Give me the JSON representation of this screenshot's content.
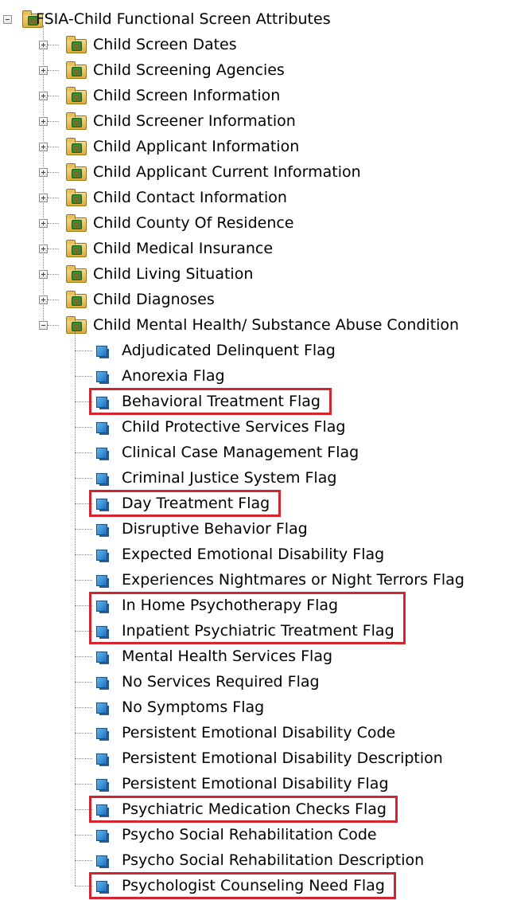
{
  "root": {
    "label": "FSIA-Child Functional Screen Attributes",
    "expanded": true,
    "folders": [
      {
        "label": "Child Screen Dates",
        "expanded": false
      },
      {
        "label": "Child Screening Agencies",
        "expanded": false
      },
      {
        "label": "Child Screen Information",
        "expanded": false
      },
      {
        "label": "Child Screener Information",
        "expanded": false
      },
      {
        "label": "Child Applicant Information",
        "expanded": false
      },
      {
        "label": "Child Applicant Current Information",
        "expanded": false
      },
      {
        "label": "Child Contact Information",
        "expanded": false
      },
      {
        "label": "Child County Of Residence",
        "expanded": false
      },
      {
        "label": "Child Medical Insurance",
        "expanded": false
      },
      {
        "label": "Child Living Situation",
        "expanded": false
      },
      {
        "label": "Child Diagnoses",
        "expanded": false
      },
      {
        "label": "Child Mental Health/ Substance Abuse Condition",
        "expanded": true,
        "items": [
          {
            "label": "Adjudicated Delinquent Flag",
            "highlighted": false
          },
          {
            "label": "Anorexia Flag",
            "highlighted": false
          },
          {
            "label": "Behavioral Treatment Flag",
            "highlighted": true
          },
          {
            "label": "Child Protective Services Flag",
            "highlighted": false
          },
          {
            "label": "Clinical Case Management Flag",
            "highlighted": false
          },
          {
            "label": "Criminal Justice System Flag",
            "highlighted": false
          },
          {
            "label": "Day Treatment Flag",
            "highlighted": true
          },
          {
            "label": "Disruptive Behavior Flag",
            "highlighted": false
          },
          {
            "label": "Expected Emotional Disability Flag",
            "highlighted": false
          },
          {
            "label": "Experiences Nightmares or Night Terrors Flag",
            "highlighted": false
          },
          {
            "label": "In Home Psychotherapy Flag",
            "highlighted": true
          },
          {
            "label": "Inpatient Psychiatric Treatment Flag",
            "highlighted": true
          },
          {
            "label": "Mental Health Services Flag",
            "highlighted": false
          },
          {
            "label": "No Services Required Flag",
            "highlighted": false
          },
          {
            "label": "No Symptoms Flag",
            "highlighted": false
          },
          {
            "label": "Persistent Emotional Disability Code",
            "highlighted": false
          },
          {
            "label": "Persistent Emotional Disability Description",
            "highlighted": false
          },
          {
            "label": "Persistent Emotional Disability Flag",
            "highlighted": false
          },
          {
            "label": "Psychiatric Medication Checks Flag",
            "highlighted": true
          },
          {
            "label": "Psycho Social Rehabilitation Code",
            "highlighted": false
          },
          {
            "label": "Psycho Social Rehabilitation Description",
            "highlighted": false
          },
          {
            "label": "Psychologist Counseling Need Flag",
            "highlighted": true
          }
        ]
      }
    ]
  },
  "colors": {
    "highlight_border": "#d6242e",
    "tree_lines": "#8c8c8c"
  },
  "icons": {
    "folder": "folder-attribute-icon",
    "attribute": "attribute-icon",
    "expander_collapsed": "expand-plus-icon",
    "expander_expanded": "collapse-minus-icon"
  }
}
